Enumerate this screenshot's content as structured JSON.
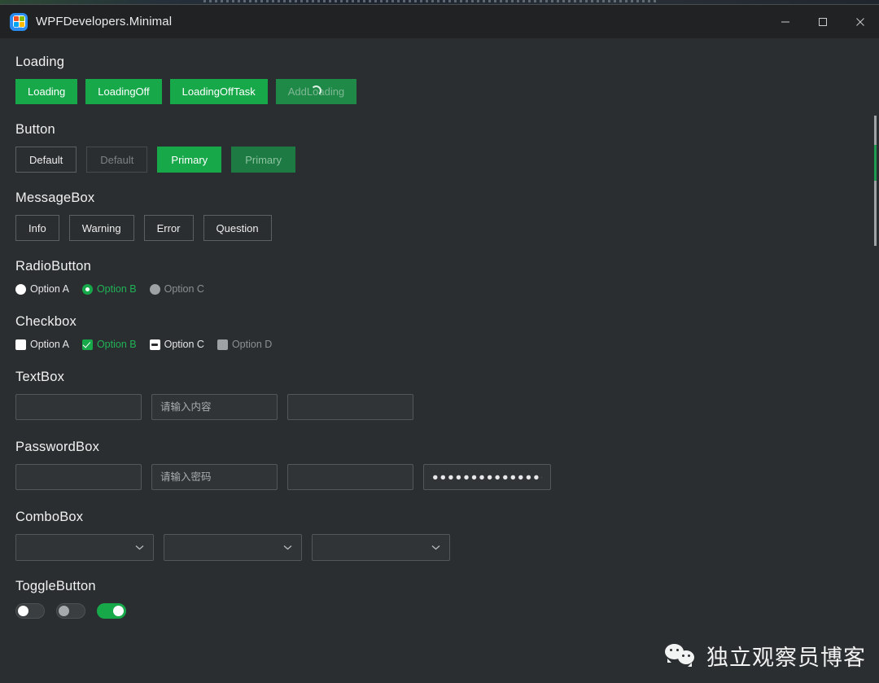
{
  "window": {
    "title": "WPFDevelopers.Minimal",
    "app_icon": "wpf-app-icon",
    "controls": [
      {
        "name": "minimize",
        "glyph": "minimize-icon"
      },
      {
        "name": "maximize",
        "glyph": "maximize-icon"
      },
      {
        "name": "close",
        "glyph": "close-icon"
      }
    ]
  },
  "colors": {
    "accent_green": "#17a84a",
    "accent_green_disabled": "#1d7a42",
    "window_bg": "#2b2e30",
    "titlebar_bg": "#202223",
    "input_bg": "#313436",
    "border": "#53575a",
    "text": "#ededed",
    "text_disabled": "#8b9093"
  },
  "sections": {
    "loading": {
      "title": "Loading",
      "buttons": [
        {
          "label": "Loading",
          "state": "enabled"
        },
        {
          "label": "LoadingOff",
          "state": "enabled"
        },
        {
          "label": "LoadingOffTask",
          "state": "enabled"
        },
        {
          "label": "AddLoading",
          "state": "loading"
        }
      ]
    },
    "button": {
      "title": "Button",
      "buttons": [
        {
          "label": "Default",
          "style": "default",
          "state": "enabled"
        },
        {
          "label": "Default",
          "style": "default",
          "state": "disabled"
        },
        {
          "label": "Primary",
          "style": "primary",
          "state": "enabled"
        },
        {
          "label": "Primary",
          "style": "primary",
          "state": "disabled"
        }
      ]
    },
    "messagebox": {
      "title": "MessageBox",
      "buttons": [
        {
          "label": "Info"
        },
        {
          "label": "Warning"
        },
        {
          "label": "Error"
        },
        {
          "label": "Question"
        }
      ]
    },
    "radiobutton": {
      "title": "RadioButton",
      "options": [
        {
          "label": "Option A",
          "state": "unchecked"
        },
        {
          "label": "Option B",
          "state": "checked"
        },
        {
          "label": "Option C",
          "state": "disabled"
        }
      ]
    },
    "checkbox": {
      "title": "Checkbox",
      "options": [
        {
          "label": "Option A",
          "state": "unchecked"
        },
        {
          "label": "Option B",
          "state": "checked"
        },
        {
          "label": "Option C",
          "state": "indeterminate"
        },
        {
          "label": "Option D",
          "state": "disabled"
        }
      ]
    },
    "textbox": {
      "title": "TextBox",
      "fields": [
        {
          "value": "",
          "placeholder": ""
        },
        {
          "value": "",
          "placeholder": "请输入内容"
        },
        {
          "value": "",
          "placeholder": ""
        }
      ]
    },
    "passwordbox": {
      "title": "PasswordBox",
      "fields": [
        {
          "value": "",
          "placeholder": ""
        },
        {
          "value": "",
          "placeholder": "请输入密码"
        },
        {
          "value": "",
          "placeholder": ""
        },
        {
          "value": "●●●●●●●●●●●●●●●●●●●",
          "placeholder": ""
        }
      ]
    },
    "combobox": {
      "title": "ComboBox",
      "fields": [
        {
          "value": "",
          "icon": "chevron-down-icon"
        },
        {
          "value": "",
          "icon": "chevron-down-icon"
        },
        {
          "value": "",
          "icon": "chevron-down-icon"
        }
      ]
    },
    "togglebutton": {
      "title": "ToggleButton",
      "toggles": [
        {
          "state": "off"
        },
        {
          "state": "off-disabled"
        },
        {
          "state": "on"
        }
      ]
    }
  },
  "watermark": {
    "icon": "wechat-icon",
    "text": "独立观察员博客"
  },
  "scrollbar": {
    "name": "vertical-scrollbar"
  }
}
